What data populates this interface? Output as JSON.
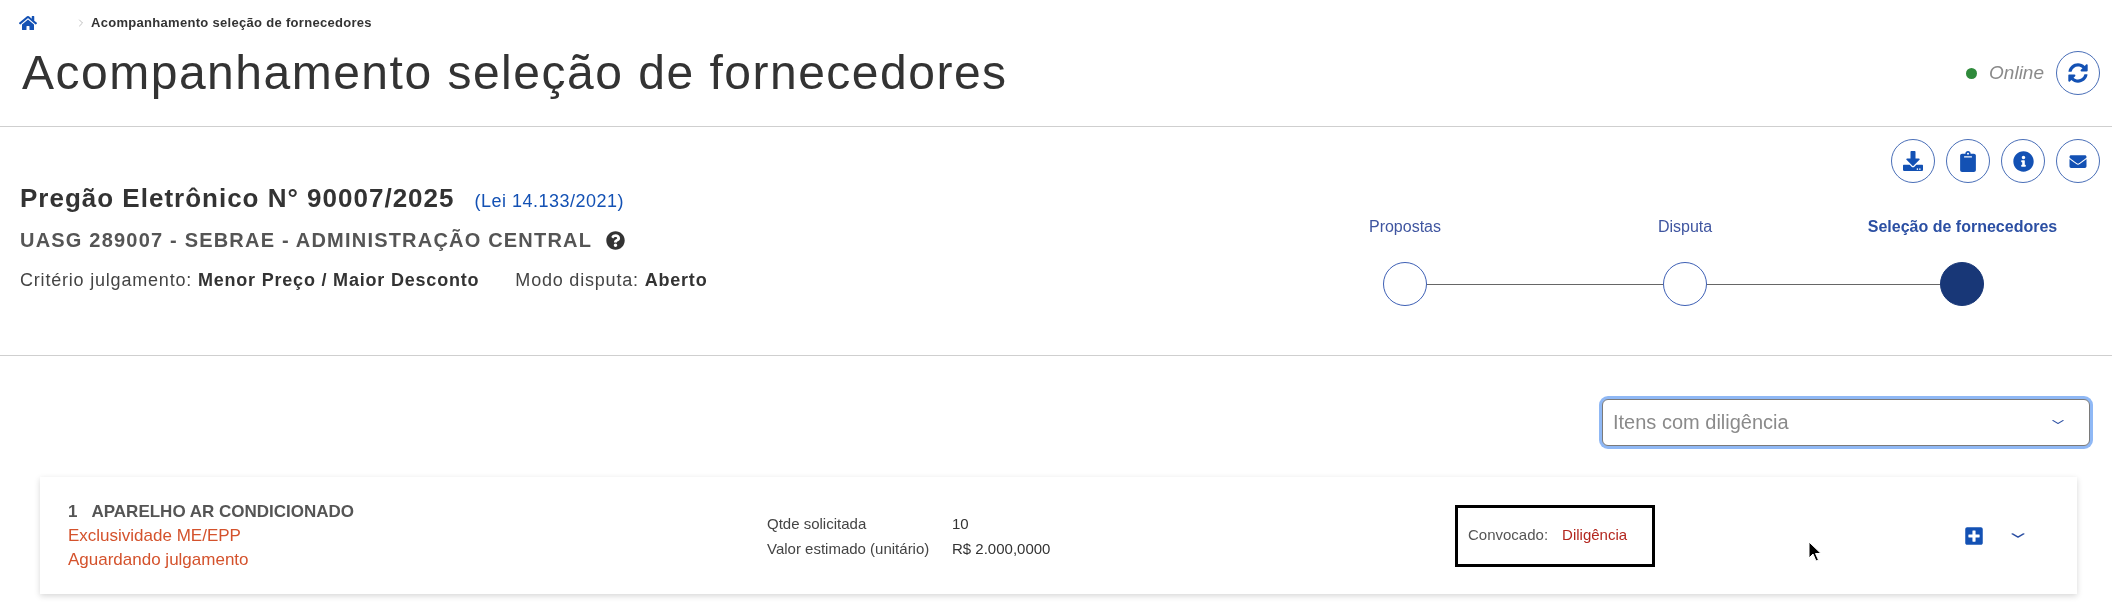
{
  "breadcrumb": {
    "current": "Acompanhamento seleção de fornecedores"
  },
  "page_title": "Acompanhamento seleção de fornecedores",
  "connection": {
    "status": "Online",
    "online": true
  },
  "procurement": {
    "title": "Pregão Eletrônico N° 90007/2025",
    "law": "(Lei 14.133/2021)",
    "agency": "UASG 289007 - SEBRAE - ADMINISTRAÇÃO CENTRAL",
    "details": [
      {
        "label": "Critério julgamento:",
        "value": "Menor Preço / Maior Desconto"
      },
      {
        "label": "Modo disputa:",
        "value": "Aberto"
      }
    ]
  },
  "stepper": {
    "steps": [
      {
        "label": "Propostas",
        "selected": false
      },
      {
        "label": "Disputa",
        "selected": false
      },
      {
        "label": "Seleção de fornecedores",
        "selected": true
      }
    ]
  },
  "filter": {
    "placeholder": "Itens com diligência",
    "focused": true
  },
  "items": [
    {
      "number": "1",
      "name": "APARELHO AR CONDICIONADO",
      "tags": [
        "Exclusividade ME/EPP",
        "Aguardando julgamento"
      ],
      "fields": [
        {
          "label": "Qtde solicitada",
          "value": "10"
        },
        {
          "label": "Valor estimado (unitário)",
          "value": "R$ 2.000,0000"
        }
      ],
      "status": {
        "label": "Convocado:",
        "value": "Diligência",
        "highlighted": true
      },
      "expanded": false
    }
  ]
}
